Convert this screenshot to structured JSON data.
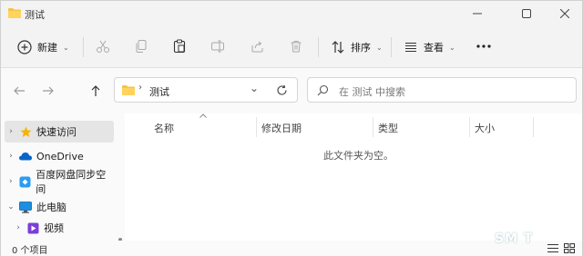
{
  "window": {
    "title": "测试"
  },
  "toolbar": {
    "new_label": "新建",
    "sort_label": "排序",
    "view_label": "查看"
  },
  "address": {
    "segment": "测试"
  },
  "search": {
    "placeholder": "在 测试 中搜索"
  },
  "nav": {
    "items": [
      {
        "label": "快速访问",
        "icon": "star-icon"
      },
      {
        "label": "OneDrive",
        "icon": "cloud-icon"
      },
      {
        "label": "百度网盘同步空间",
        "icon": "baidu-netdisk-icon"
      },
      {
        "label": "此电脑",
        "icon": "computer-icon"
      },
      {
        "label": "视频",
        "icon": "video-folder-icon"
      }
    ]
  },
  "columns": [
    "名称",
    "修改日期",
    "类型",
    "大小"
  ],
  "content": {
    "empty_message": "此文件夹为空。"
  },
  "status": {
    "items_count": "0 个项目"
  },
  "watermark": "SM  T",
  "colors": {
    "accent": "#0067c0",
    "folder": "#f6c444",
    "star": "#f5b400"
  }
}
